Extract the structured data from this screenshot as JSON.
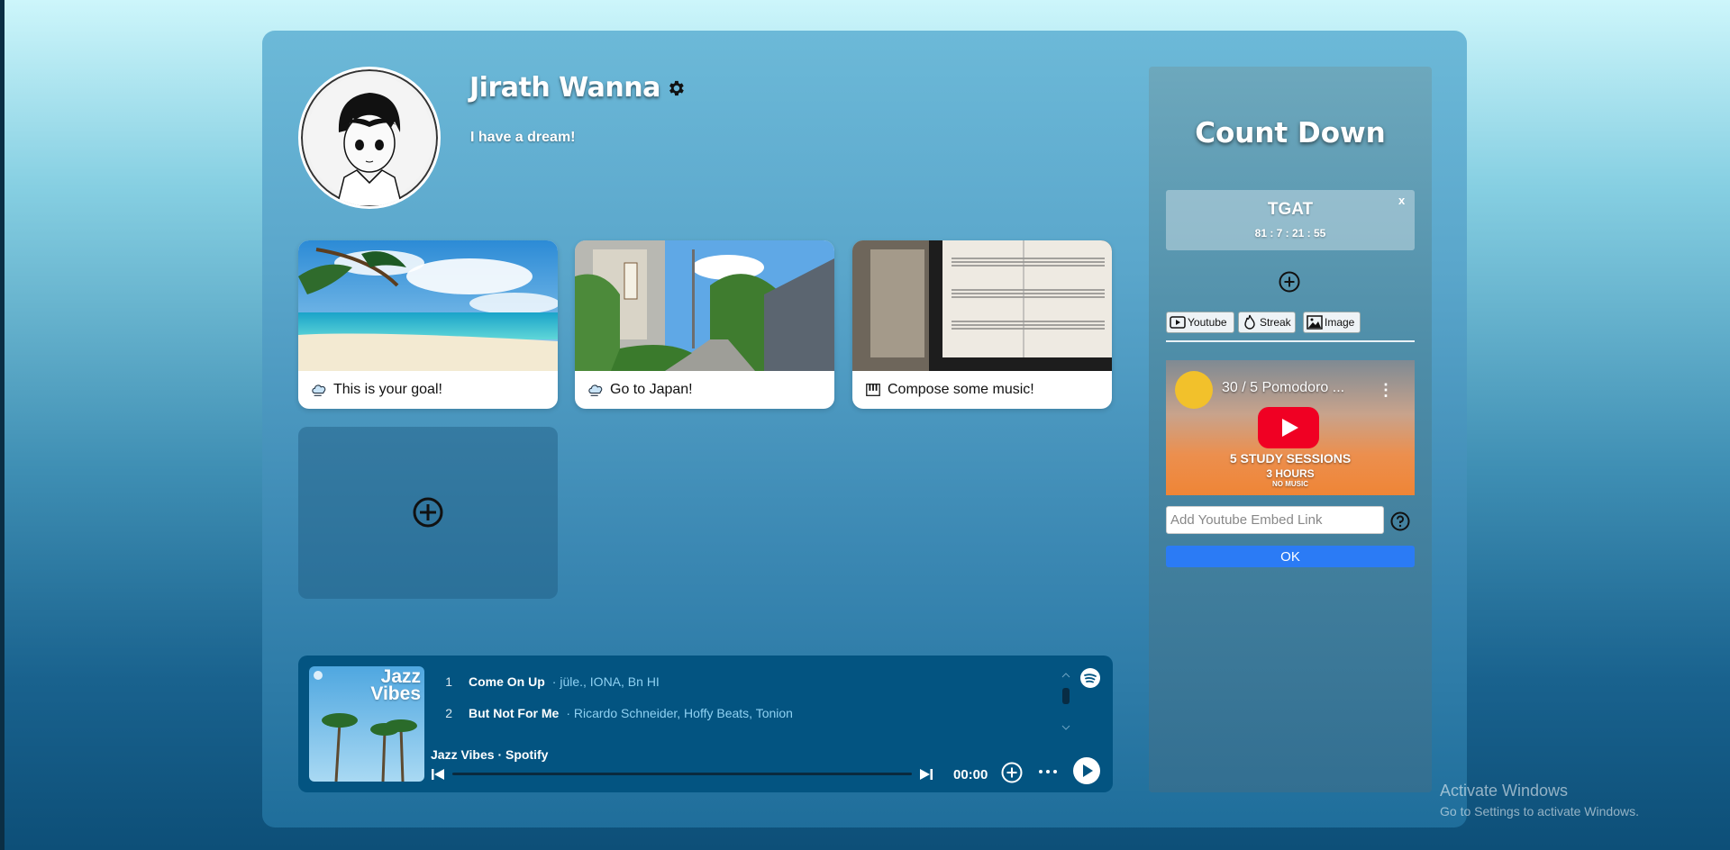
{
  "profile": {
    "name": "Jirath Wanna",
    "bio": "I have a dream!"
  },
  "goals": [
    {
      "label": "This is your goal!",
      "icon": "cloud-icon"
    },
    {
      "label": "Go to Japan!",
      "icon": "cloud-icon"
    },
    {
      "label": "Compose some music!",
      "icon": "piano-icon"
    }
  ],
  "player": {
    "album_title": "Jazz Vibes",
    "tracks": [
      {
        "num": "1",
        "title": "Come On Up",
        "artists": "· jüle., IONA, Bn HI"
      },
      {
        "num": "2",
        "title": "But Not For Me",
        "artists": "· Ricardo Schneider, Hoffy Beats, Tonion"
      }
    ],
    "label": "Jazz Vibes · Spotify",
    "time": "00:00"
  },
  "countdown": {
    "title": "Count Down",
    "timer_name": "TGAT",
    "timer_value": "81 : 7 : 21 : 55",
    "close": "x",
    "tabs": [
      {
        "label": "Youtube",
        "icon": "youtube-icon"
      },
      {
        "label": "Streak",
        "icon": "flame-icon"
      },
      {
        "label": "Image",
        "icon": "image-icon"
      }
    ],
    "video": {
      "title": "30 / 5 Pomodoro ...",
      "overlay_line1": "5 STUDY SESSIONS",
      "overlay_line2": "3 HOURS",
      "overlay_line3": "NO MUSIC"
    },
    "embed_placeholder": "Add Youtube Embed Link",
    "ok_label": "OK"
  },
  "os_watermark": {
    "title": "Activate Windows",
    "subtitle": "Go to Settings to activate Windows."
  }
}
